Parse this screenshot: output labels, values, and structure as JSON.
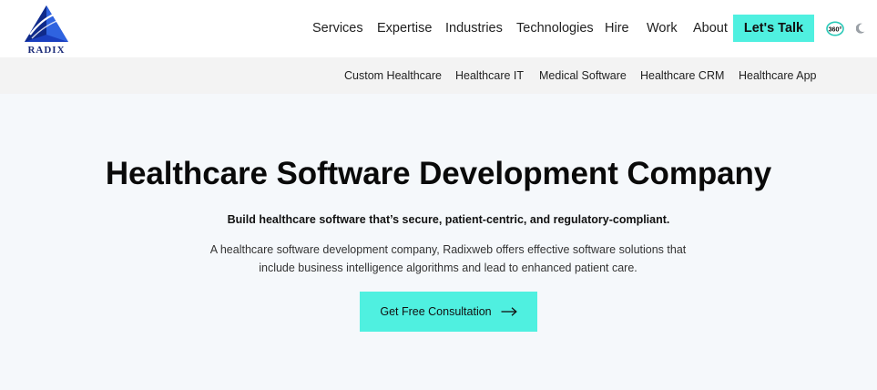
{
  "brand": {
    "logo_text": "RADIX",
    "accent": "#4ff0e0",
    "logo_blue": "#1a3fbf"
  },
  "nav": {
    "items": [
      {
        "label": "Services"
      },
      {
        "label": "Expertise"
      },
      {
        "label": "Industries"
      },
      {
        "label": "Technologies"
      },
      {
        "label": "Hire"
      },
      {
        "label": "Work"
      },
      {
        "label": "About"
      }
    ],
    "cta_label": "Let's Talk",
    "badge_text": "360°",
    "theme_toggle_icon": "moon-icon"
  },
  "subnav": {
    "items": [
      {
        "label": "Custom Healthcare"
      },
      {
        "label": "Healthcare IT"
      },
      {
        "label": "Medical Software"
      },
      {
        "label": "Healthcare CRM"
      },
      {
        "label": "Healthcare App"
      }
    ]
  },
  "hero": {
    "title": "Healthcare Software Development Company",
    "subtitle": "Build healthcare software that’s secure, patient-centric, and regulatory-compliant.",
    "description": "A healthcare software development company, Radixweb offers effective software solutions that include business intelligence algorithms and lead to enhanced patient care.",
    "button_label": "Get Free Consultation",
    "button_icon": "arrow-right-icon"
  }
}
